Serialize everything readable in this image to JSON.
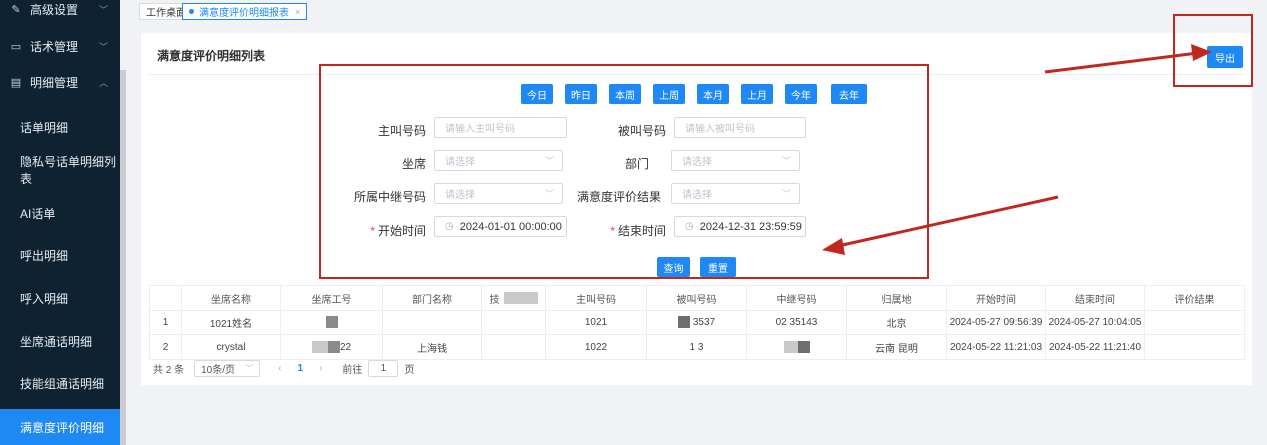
{
  "sidebar": {
    "groups": [
      {
        "label": "高级设置",
        "icon": "pen-icon"
      },
      {
        "label": "话术管理",
        "icon": "chat-icon"
      },
      {
        "label": "明细管理",
        "icon": "document-icon"
      }
    ],
    "items": [
      "话单明细",
      "隐私号话单明细列表",
      "AI话单",
      "呼出明细",
      "呼入明细",
      "坐席通话明细",
      "技能组通话明细",
      "满意度评价明细"
    ],
    "active_index": 7
  },
  "tabs": [
    {
      "label": "工作桌面",
      "active": false
    },
    {
      "label": "满意度评价明细报表",
      "active": true
    }
  ],
  "page": {
    "title": "满意度评价明细列表",
    "export_label": "导出",
    "quick_ranges": [
      "今日",
      "昨日",
      "本周",
      "上周",
      "本月",
      "上月",
      "今年",
      "去年"
    ],
    "filters": {
      "caller_label": "主叫号码",
      "caller_placeholder": "请输入主叫号码",
      "callee_label": "被叫号码",
      "callee_placeholder": "请输入被叫号码",
      "agent_label": "坐席",
      "agent_placeholder": "请选择",
      "dept_label": "部门",
      "dept_placeholder": "请选择",
      "trunk_label": "所属中继号码",
      "trunk_placeholder": "请选择",
      "result_label": "满意度评价结果",
      "result_placeholder": "请选择",
      "start_label": "开始时间",
      "start_value": "2024-01-01 00:00:00",
      "end_label": "结束时间",
      "end_value": "2024-12-31 23:59:59"
    },
    "query_label": "查询",
    "reset_label": "重置"
  },
  "table": {
    "columns": [
      "",
      "坐席名称",
      "坐席工号",
      "部门名称",
      "技",
      "主叫号码",
      "被叫号码",
      "中继号码",
      "归属地",
      "开始时间",
      "结束时间",
      "评价结果"
    ],
    "rows": [
      [
        "1",
        "1021姓名",
        "",
        "",
        "",
        "1021",
        "3537",
        "02 35143",
        "北京",
        "2024-05-27 09:56:39",
        "2024-05-27 10:04:05",
        ""
      ],
      [
        "2",
        "crystal",
        "22",
        "上海钱",
        "",
        "1022",
        "1 3",
        "",
        "云南 昆明",
        "2024-05-22 11:21:03",
        "2024-05-22 11:21:40",
        ""
      ]
    ]
  },
  "pager": {
    "total": "共 2 条",
    "page_size": "10条/页",
    "current": "1",
    "goto_label": "前往",
    "goto_value": "1",
    "page_unit": "页"
  },
  "colors": {
    "accent": "#1e88f5",
    "sidebar_bg": "#0f2231",
    "annotation": "#c0271f"
  }
}
